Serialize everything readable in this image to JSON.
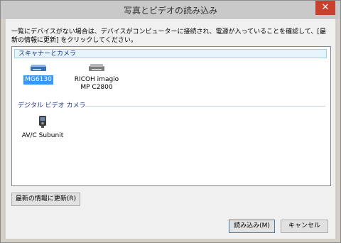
{
  "window": {
    "title": "写真とビデオの読み込み",
    "close_glyph": "✕"
  },
  "instruction": "一覧にデバイスがない場合は、デバイスがコンピューターに接続され、電源が入っていることを確認して、[最新の情報に更新] をクリックしてください。",
  "groups": [
    {
      "label": "スキャナーとカメラ",
      "devices": [
        {
          "label": "MG6130",
          "icon": "scanner-icon",
          "selected": true
        },
        {
          "label": "RICOH imagio\nMP C2800",
          "icon": "multifunction-printer-icon",
          "selected": false
        }
      ]
    },
    {
      "label": "デジタル ビデオ カメラ",
      "devices": [
        {
          "label": "AV/C Subunit",
          "icon": "video-camera-icon",
          "selected": false
        }
      ]
    }
  ],
  "buttons": {
    "refresh": "最新の情報に更新(R)",
    "import": "読み込み(M)",
    "cancel": "キャンセル"
  },
  "colors": {
    "close_button": "#c7412f",
    "selection": "#3399ff",
    "group_text": "#1e3287"
  }
}
